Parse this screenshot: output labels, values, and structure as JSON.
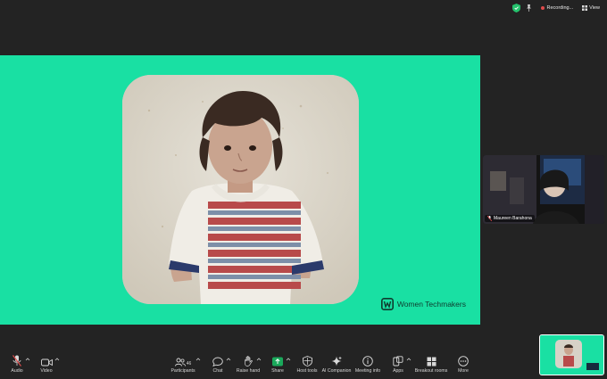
{
  "status": {
    "recording_label": "Recording...",
    "view_label": "View"
  },
  "shared_content": {
    "brand_text": "Women Techmakers",
    "background_color": "#19e0a3"
  },
  "participant_tile": {
    "name": "Maureen Barahona"
  },
  "toolbar": {
    "audio_label": "Audio",
    "video_label": "Video",
    "participants_label": "Participants",
    "participants_count": "46",
    "chat_label": "Chat",
    "raise_hand_label": "Raise hand",
    "share_label": "Share",
    "host_tools_label": "Host tools",
    "ai_companion_label": "AI Companion",
    "meeting_info_label": "Meeting info",
    "apps_label": "Apps",
    "breakout_rooms_label": "Breakout rooms",
    "more_label": "More"
  },
  "colors": {
    "accent_green": "#19e0a3",
    "share_green": "#1aa95b",
    "mute_red": "#e04b4b",
    "window_bg": "#232323"
  }
}
